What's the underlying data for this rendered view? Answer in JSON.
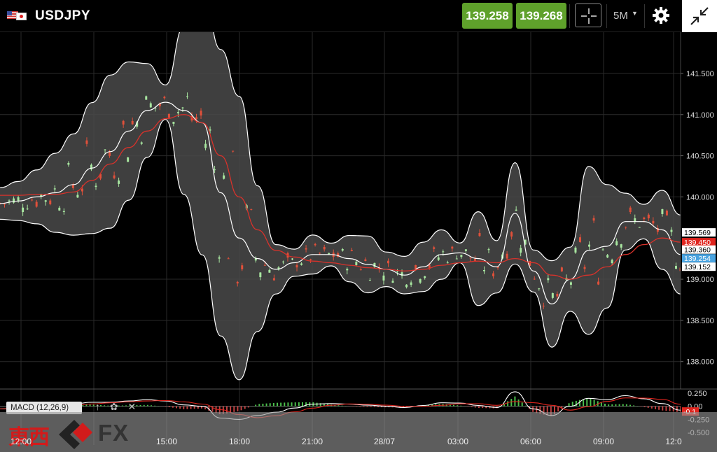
{
  "header": {
    "symbol": "USDJPY",
    "sell_price": "139.258",
    "buy_price": "139.268",
    "timeframe": "5M",
    "icons": [
      "us-flag-icon",
      "japan-flag-icon",
      "crosshair-icon",
      "gear-icon",
      "collapse-icon"
    ]
  },
  "colors": {
    "price_button": "#5fa12b",
    "bands": "#ffffff",
    "band_fill": "#4a4a4a",
    "moving_average": "#d9322b",
    "candle_up": "#a8e6a0",
    "candle_down": "#e0503a",
    "current_price_tag": "#4aa3df",
    "macd_signal": "#e0251e"
  },
  "price_axis": {
    "ticks": [
      "141.500",
      "141.000",
      "140.500",
      "140.000",
      "139.000",
      "138.500",
      "138.000"
    ],
    "tags": {
      "upper": "139.569",
      "red": "139.450",
      "middle": "139.360",
      "current": "139.254",
      "lower": "139.152"
    }
  },
  "macd_panel": {
    "label": "MACD (12,26,9)",
    "ticks": [
      "0.250",
      "0.00",
      "-0.250",
      "-0.500"
    ],
    "value_tag": "-0.1"
  },
  "time_axis": {
    "labels": [
      "12:00",
      "15:00",
      "18:00",
      "21:00",
      "28/07",
      "03:00",
      "06:00",
      "09:00",
      "12:0"
    ]
  },
  "branding": {
    "kanji": "東西",
    "fx": "FX"
  },
  "chart_data": {
    "type": "line",
    "title": "",
    "series": [
      {
        "name": "",
        "values": [
          139.92,
          139.95,
          140.0,
          140.05,
          140.15,
          140.35,
          140.55,
          140.8,
          141.05,
          141.15,
          141.05,
          140.9,
          140.05,
          139.5,
          139.25,
          139.12,
          139.2,
          139.3,
          139.3,
          139.25,
          139.18,
          139.12,
          139.05,
          139.15,
          139.3,
          139.32,
          139.25,
          139.15,
          139.8,
          139.1,
          138.7,
          139.0,
          139.35,
          139.4,
          139.7,
          139.7,
          139.6,
          139.3
        ]
      },
      {
        "name": "",
        "values": [
          140.02,
          140.02,
          140.03,
          140.03,
          140.06,
          140.2,
          140.4,
          140.6,
          140.8,
          140.95,
          141.0,
          140.9,
          140.5,
          140.0,
          139.6,
          139.35,
          139.27,
          139.22,
          139.2,
          139.17,
          139.14,
          139.12,
          139.1,
          139.12,
          139.17,
          139.2,
          139.22,
          139.2,
          139.25,
          139.2,
          139.05,
          139.0,
          139.05,
          139.15,
          139.3,
          139.42,
          139.5,
          139.45
        ]
      }
    ],
    "ylim": [
      137.7,
      141.95
    ]
  }
}
